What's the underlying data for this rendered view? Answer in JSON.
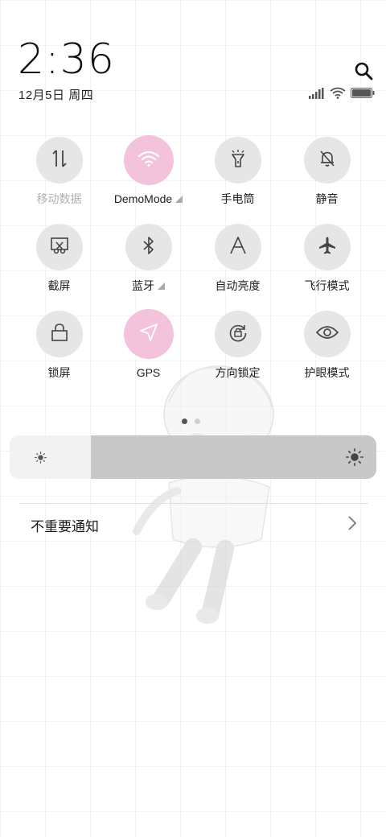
{
  "status": {
    "time": "2:36",
    "date": "12月5日 周四"
  },
  "tiles": [
    {
      "label": "移动数据",
      "icon": "mobile-data-icon",
      "active": false,
      "disabled": true
    },
    {
      "label": "DemoMode",
      "icon": "wifi-icon",
      "active": true,
      "expandable": true
    },
    {
      "label": "手电筒",
      "icon": "flashlight-icon",
      "active": false
    },
    {
      "label": "静音",
      "icon": "bell-off-icon",
      "active": false
    },
    {
      "label": "截屏",
      "icon": "screenshot-icon",
      "active": false
    },
    {
      "label": "蓝牙",
      "icon": "bluetooth-icon",
      "active": false,
      "expandable": true
    },
    {
      "label": "自动亮度",
      "icon": "auto-brightness-icon",
      "active": false
    },
    {
      "label": "飞行模式",
      "icon": "airplane-icon",
      "active": false
    },
    {
      "label": "锁屏",
      "icon": "lock-icon",
      "active": false
    },
    {
      "label": "GPS",
      "icon": "location-icon",
      "active": true
    },
    {
      "label": "方向锁定",
      "icon": "rotation-lock-icon",
      "active": false
    },
    {
      "label": "护眼模式",
      "icon": "eye-icon",
      "active": false
    }
  ],
  "pager": {
    "pages": 2,
    "current": 1
  },
  "brightness": {
    "level": 0.2
  },
  "notifications": {
    "label": "不重要通知"
  },
  "colors": {
    "active_tile": "#f3c3dc",
    "inactive_tile": "#e6e6e6"
  }
}
